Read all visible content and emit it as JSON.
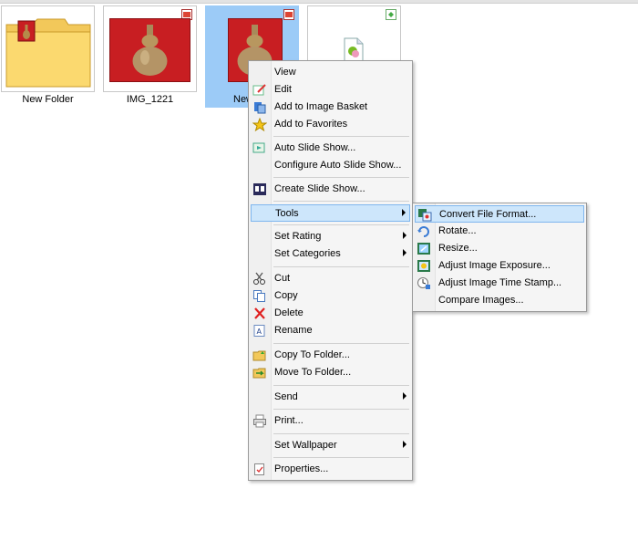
{
  "thumbnails": [
    {
      "caption": "New Folder",
      "kind": "folder"
    },
    {
      "caption": "IMG_1221",
      "kind": "photo"
    },
    {
      "caption": "New",
      "kind": "photo-selected"
    },
    {
      "caption": "",
      "kind": "document"
    }
  ],
  "context_menu": {
    "items": [
      {
        "label": "View",
        "icon": "none"
      },
      {
        "label": "Edit",
        "icon": "edit-icon"
      },
      {
        "label": "Add to Image Basket",
        "icon": "basket-icon"
      },
      {
        "label": "Add to Favorites",
        "icon": "star-icon"
      },
      {
        "label": "Auto Slide Show...",
        "icon": "slideshow-icon"
      },
      {
        "label": "Configure Auto Slide Show...",
        "icon": "none"
      },
      {
        "label": "Create Slide Show...",
        "icon": "create-slideshow-icon"
      },
      {
        "label": "Tools",
        "icon": "none",
        "submenu": true
      },
      {
        "label": "Set Rating",
        "icon": "none",
        "submenu": true
      },
      {
        "label": "Set Categories",
        "icon": "none",
        "submenu": true
      },
      {
        "label": "Cut",
        "icon": "scissors-icon"
      },
      {
        "label": "Copy",
        "icon": "copy-icon"
      },
      {
        "label": "Delete",
        "icon": "delete-icon"
      },
      {
        "label": "Rename",
        "icon": "rename-icon"
      },
      {
        "label": "Copy To Folder...",
        "icon": "copy-folder-icon"
      },
      {
        "label": "Move To Folder...",
        "icon": "move-folder-icon"
      },
      {
        "label": "Send",
        "icon": "none",
        "submenu": true
      },
      {
        "label": "Print...",
        "icon": "printer-icon"
      },
      {
        "label": "Set Wallpaper",
        "icon": "none",
        "submenu": true
      },
      {
        "label": "Properties...",
        "icon": "properties-icon"
      }
    ]
  },
  "tools_submenu": {
    "items": [
      {
        "label": "Convert File Format...",
        "icon": "convert-icon"
      },
      {
        "label": "Rotate...",
        "icon": "rotate-icon"
      },
      {
        "label": "Resize...",
        "icon": "resize-icon"
      },
      {
        "label": "Adjust Image Exposure...",
        "icon": "exposure-icon"
      },
      {
        "label": "Adjust Image Time Stamp...",
        "icon": "timestamp-icon"
      },
      {
        "label": "Compare Images...",
        "icon": "none"
      }
    ]
  },
  "colors": {
    "selection": "#9ccbf7",
    "menu_highlight": "#cde6fb",
    "menu_highlight_border": "#7fb6ee"
  }
}
